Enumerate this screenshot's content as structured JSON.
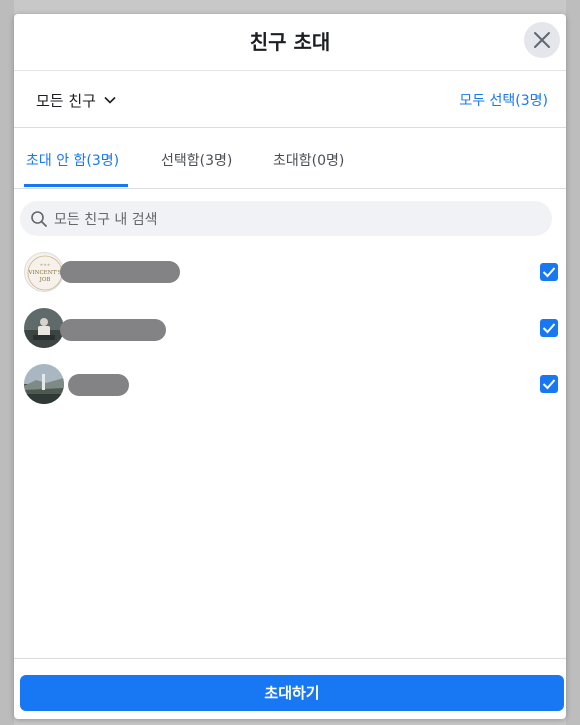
{
  "dialog": {
    "title": "친구 초대"
  },
  "filter": {
    "label": "모든 친구",
    "select_all": "모두 선택(3명)"
  },
  "tabs": [
    {
      "label": "초대 안 함(3명)",
      "active": true
    },
    {
      "label": "선택함(3명)",
      "active": false
    },
    {
      "label": "초대함(0명)",
      "active": false
    }
  ],
  "search": {
    "placeholder": "모든 친구 내 검색"
  },
  "friends": [
    {
      "avatar_text": "VINCENT'S JOB",
      "checked": true
    },
    {
      "avatar_text": "",
      "checked": true
    },
    {
      "avatar_text": "",
      "checked": true
    }
  ],
  "footer": {
    "invite_label": "초대하기"
  },
  "colors": {
    "accent": "#1877f2",
    "redaction": "#838385"
  }
}
